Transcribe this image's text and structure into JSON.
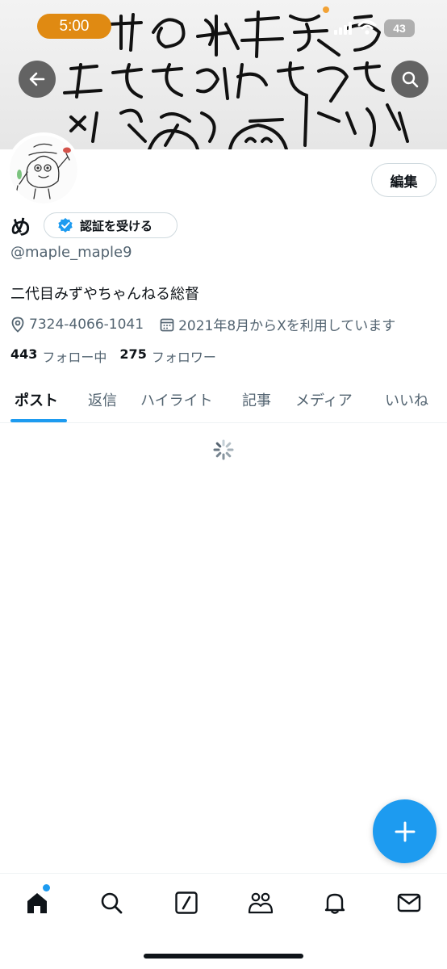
{
  "status_bar": {
    "time": "5:00",
    "battery": "43"
  },
  "banner": {
    "alt_icon": "handwritten-banner"
  },
  "profile": {
    "name": "め",
    "verify_label": "認証を受ける",
    "handle": "@maple_maple9",
    "bio": "二代目みずやちゃんねる総督",
    "location": "7324-4066-1041",
    "joined": "2021年8月からXを利用しています",
    "following_count": "443",
    "following_label": "フォロー中",
    "followers_count": "275",
    "followers_label": "フォロワー"
  },
  "edit_label": "編集",
  "tabs": [
    {
      "label": "ポスト"
    },
    {
      "label": "返信"
    },
    {
      "label": "ハイライト"
    },
    {
      "label": "記事"
    },
    {
      "label": "メディア"
    },
    {
      "label": "いいね"
    }
  ],
  "colors": {
    "accent": "#1d9bf0",
    "text": "#0f1419",
    "muted": "#536471",
    "status_pill": "#e08a12"
  }
}
